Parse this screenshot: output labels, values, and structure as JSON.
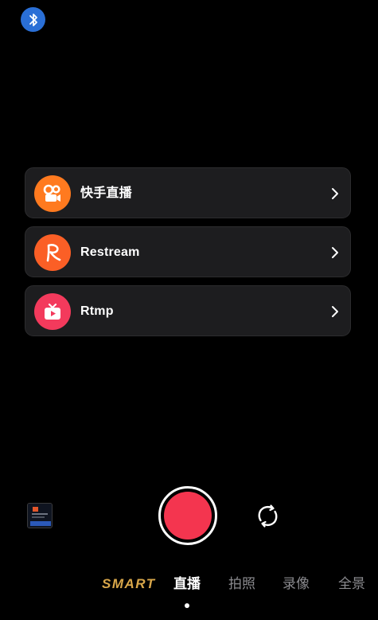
{
  "status": {
    "bluetooth_icon": "bluetooth-icon",
    "bluetooth_color": "#2a6fd6"
  },
  "stream_targets": [
    {
      "label": "快手直播",
      "icon": "kuaishou-camera-icon",
      "icon_bg": "#ff7a1f"
    },
    {
      "label": "Restream",
      "icon": "restream-r-icon",
      "icon_bg": "#fb5f26"
    },
    {
      "label": "Rtmp",
      "icon": "tv-play-icon",
      "icon_bg": "#f33a5c"
    }
  ],
  "controls": {
    "gallery_thumbnail": "gallery-thumbnail",
    "shutter_color": "#f4354f",
    "flip_icon": "camera-flip-icon"
  },
  "modes": {
    "items": [
      "SMART",
      "直播",
      "拍照",
      "录像",
      "全景"
    ],
    "active": "直播",
    "smart_color": "#d9a74a"
  }
}
